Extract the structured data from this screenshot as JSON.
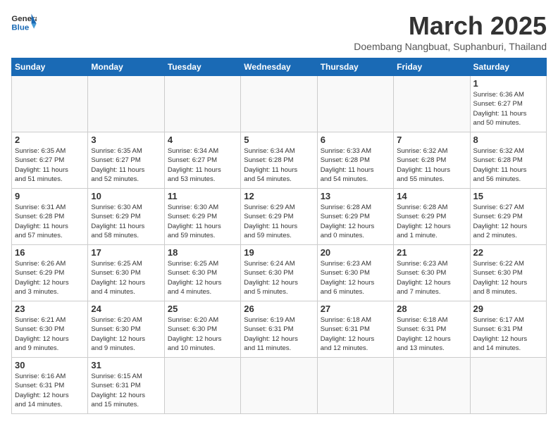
{
  "header": {
    "logo_general": "General",
    "logo_blue": "Blue",
    "title": "March 2025",
    "subtitle": "Doembang Nangbuat, Suphanburi, Thailand"
  },
  "days_of_week": [
    "Sunday",
    "Monday",
    "Tuesday",
    "Wednesday",
    "Thursday",
    "Friday",
    "Saturday"
  ],
  "weeks": [
    [
      {
        "day": "",
        "info": ""
      },
      {
        "day": "",
        "info": ""
      },
      {
        "day": "",
        "info": ""
      },
      {
        "day": "",
        "info": ""
      },
      {
        "day": "",
        "info": ""
      },
      {
        "day": "",
        "info": ""
      },
      {
        "day": "1",
        "info": "Sunrise: 6:36 AM\nSunset: 6:27 PM\nDaylight: 11 hours\nand 50 minutes."
      }
    ],
    [
      {
        "day": "2",
        "info": "Sunrise: 6:35 AM\nSunset: 6:27 PM\nDaylight: 11 hours\nand 51 minutes."
      },
      {
        "day": "3",
        "info": "Sunrise: 6:35 AM\nSunset: 6:27 PM\nDaylight: 11 hours\nand 52 minutes."
      },
      {
        "day": "4",
        "info": "Sunrise: 6:34 AM\nSunset: 6:27 PM\nDaylight: 11 hours\nand 53 minutes."
      },
      {
        "day": "5",
        "info": "Sunrise: 6:34 AM\nSunset: 6:28 PM\nDaylight: 11 hours\nand 54 minutes."
      },
      {
        "day": "6",
        "info": "Sunrise: 6:33 AM\nSunset: 6:28 PM\nDaylight: 11 hours\nand 54 minutes."
      },
      {
        "day": "7",
        "info": "Sunrise: 6:32 AM\nSunset: 6:28 PM\nDaylight: 11 hours\nand 55 minutes."
      },
      {
        "day": "8",
        "info": "Sunrise: 6:32 AM\nSunset: 6:28 PM\nDaylight: 11 hours\nand 56 minutes."
      }
    ],
    [
      {
        "day": "9",
        "info": "Sunrise: 6:31 AM\nSunset: 6:28 PM\nDaylight: 11 hours\nand 57 minutes."
      },
      {
        "day": "10",
        "info": "Sunrise: 6:30 AM\nSunset: 6:29 PM\nDaylight: 11 hours\nand 58 minutes."
      },
      {
        "day": "11",
        "info": "Sunrise: 6:30 AM\nSunset: 6:29 PM\nDaylight: 11 hours\nand 59 minutes."
      },
      {
        "day": "12",
        "info": "Sunrise: 6:29 AM\nSunset: 6:29 PM\nDaylight: 11 hours\nand 59 minutes."
      },
      {
        "day": "13",
        "info": "Sunrise: 6:28 AM\nSunset: 6:29 PM\nDaylight: 12 hours\nand 0 minutes."
      },
      {
        "day": "14",
        "info": "Sunrise: 6:28 AM\nSunset: 6:29 PM\nDaylight: 12 hours\nand 1 minute."
      },
      {
        "day": "15",
        "info": "Sunrise: 6:27 AM\nSunset: 6:29 PM\nDaylight: 12 hours\nand 2 minutes."
      }
    ],
    [
      {
        "day": "16",
        "info": "Sunrise: 6:26 AM\nSunset: 6:29 PM\nDaylight: 12 hours\nand 3 minutes."
      },
      {
        "day": "17",
        "info": "Sunrise: 6:25 AM\nSunset: 6:30 PM\nDaylight: 12 hours\nand 4 minutes."
      },
      {
        "day": "18",
        "info": "Sunrise: 6:25 AM\nSunset: 6:30 PM\nDaylight: 12 hours\nand 4 minutes."
      },
      {
        "day": "19",
        "info": "Sunrise: 6:24 AM\nSunset: 6:30 PM\nDaylight: 12 hours\nand 5 minutes."
      },
      {
        "day": "20",
        "info": "Sunrise: 6:23 AM\nSunset: 6:30 PM\nDaylight: 12 hours\nand 6 minutes."
      },
      {
        "day": "21",
        "info": "Sunrise: 6:23 AM\nSunset: 6:30 PM\nDaylight: 12 hours\nand 7 minutes."
      },
      {
        "day": "22",
        "info": "Sunrise: 6:22 AM\nSunset: 6:30 PM\nDaylight: 12 hours\nand 8 minutes."
      }
    ],
    [
      {
        "day": "23",
        "info": "Sunrise: 6:21 AM\nSunset: 6:30 PM\nDaylight: 12 hours\nand 9 minutes."
      },
      {
        "day": "24",
        "info": "Sunrise: 6:20 AM\nSunset: 6:30 PM\nDaylight: 12 hours\nand 9 minutes."
      },
      {
        "day": "25",
        "info": "Sunrise: 6:20 AM\nSunset: 6:30 PM\nDaylight: 12 hours\nand 10 minutes."
      },
      {
        "day": "26",
        "info": "Sunrise: 6:19 AM\nSunset: 6:31 PM\nDaylight: 12 hours\nand 11 minutes."
      },
      {
        "day": "27",
        "info": "Sunrise: 6:18 AM\nSunset: 6:31 PM\nDaylight: 12 hours\nand 12 minutes."
      },
      {
        "day": "28",
        "info": "Sunrise: 6:18 AM\nSunset: 6:31 PM\nDaylight: 12 hours\nand 13 minutes."
      },
      {
        "day": "29",
        "info": "Sunrise: 6:17 AM\nSunset: 6:31 PM\nDaylight: 12 hours\nand 14 minutes."
      }
    ],
    [
      {
        "day": "30",
        "info": "Sunrise: 6:16 AM\nSunset: 6:31 PM\nDaylight: 12 hours\nand 14 minutes."
      },
      {
        "day": "31",
        "info": "Sunrise: 6:15 AM\nSunset: 6:31 PM\nDaylight: 12 hours\nand 15 minutes."
      },
      {
        "day": "",
        "info": ""
      },
      {
        "day": "",
        "info": ""
      },
      {
        "day": "",
        "info": ""
      },
      {
        "day": "",
        "info": ""
      },
      {
        "day": "",
        "info": ""
      }
    ]
  ]
}
